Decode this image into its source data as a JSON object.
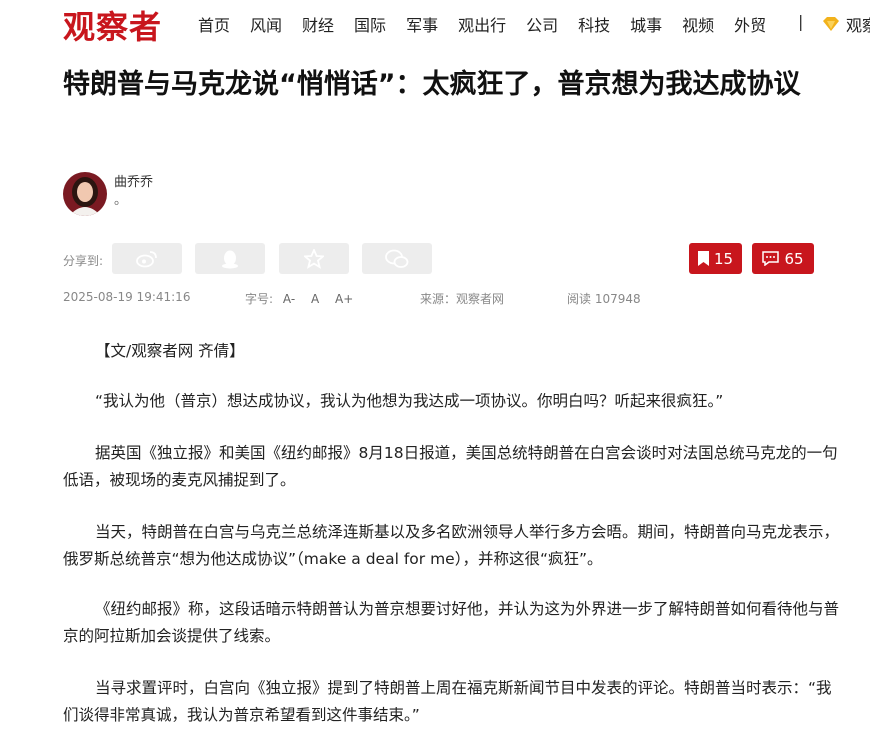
{
  "header": {
    "logo": "观察者",
    "nav": [
      "首页",
      "风闻",
      "财经",
      "国际",
      "军事",
      "观出行",
      "公司",
      "科技",
      "城事",
      "视频",
      "外贸"
    ],
    "divider": "|",
    "vip_label": "观察"
  },
  "article": {
    "title": "特朗普与马克龙说“悄悄话”：太疯狂了，普京想为我达成协议",
    "author": {
      "name": "曲乔乔",
      "desc": "。"
    },
    "share": {
      "label": "分享到:",
      "icons": [
        "weibo-icon",
        "qq-icon",
        "star-icon",
        "wechat-icon"
      ]
    },
    "bookmark_count": "15",
    "comment_count": "65",
    "meta": {
      "date": "2025-08-19 19:41:16",
      "font_label": "字号:",
      "font_small": "A-",
      "font_mid": "A",
      "font_large": "A+",
      "source": "来源：观察者网",
      "reads": "阅读 107948"
    },
    "paragraphs": [
      "【文/观察者网 齐倩】",
      "“我认为他（普京）想达成协议，我认为他想为我达成一项协议。你明白吗？听起来很疯狂。”",
      "据英国《独立报》和美国《纽约邮报》8月18日报道，美国总统特朗普在白宫会谈时对法国总统马克龙的一句低语，被现场的麦克风捕捉到了。",
      "当天，特朗普在白宫与乌克兰总统泽连斯基以及多名欧洲领导人举行多方会晤。期间，特朗普向马克龙表示，俄罗斯总统普京“想为他达成协议”（make a deal for me），并称这很“疯狂”。",
      "《纽约邮报》称，这段话暗示特朗普认为普京想要讨好他，并认为这为外界进一步了解特朗普如何看待他与普京的阿拉斯加会谈提供了线索。",
      "当寻求置评时，白宫向《独立报》提到了特朗普上周在福克斯新闻节目中发表的评论。特朗普当时表示：“我们谈得非常真诚，我认为普京希望看到这件事结束。”"
    ]
  },
  "colors": {
    "brand": "#c8161d",
    "share_bg": "#ededed"
  }
}
